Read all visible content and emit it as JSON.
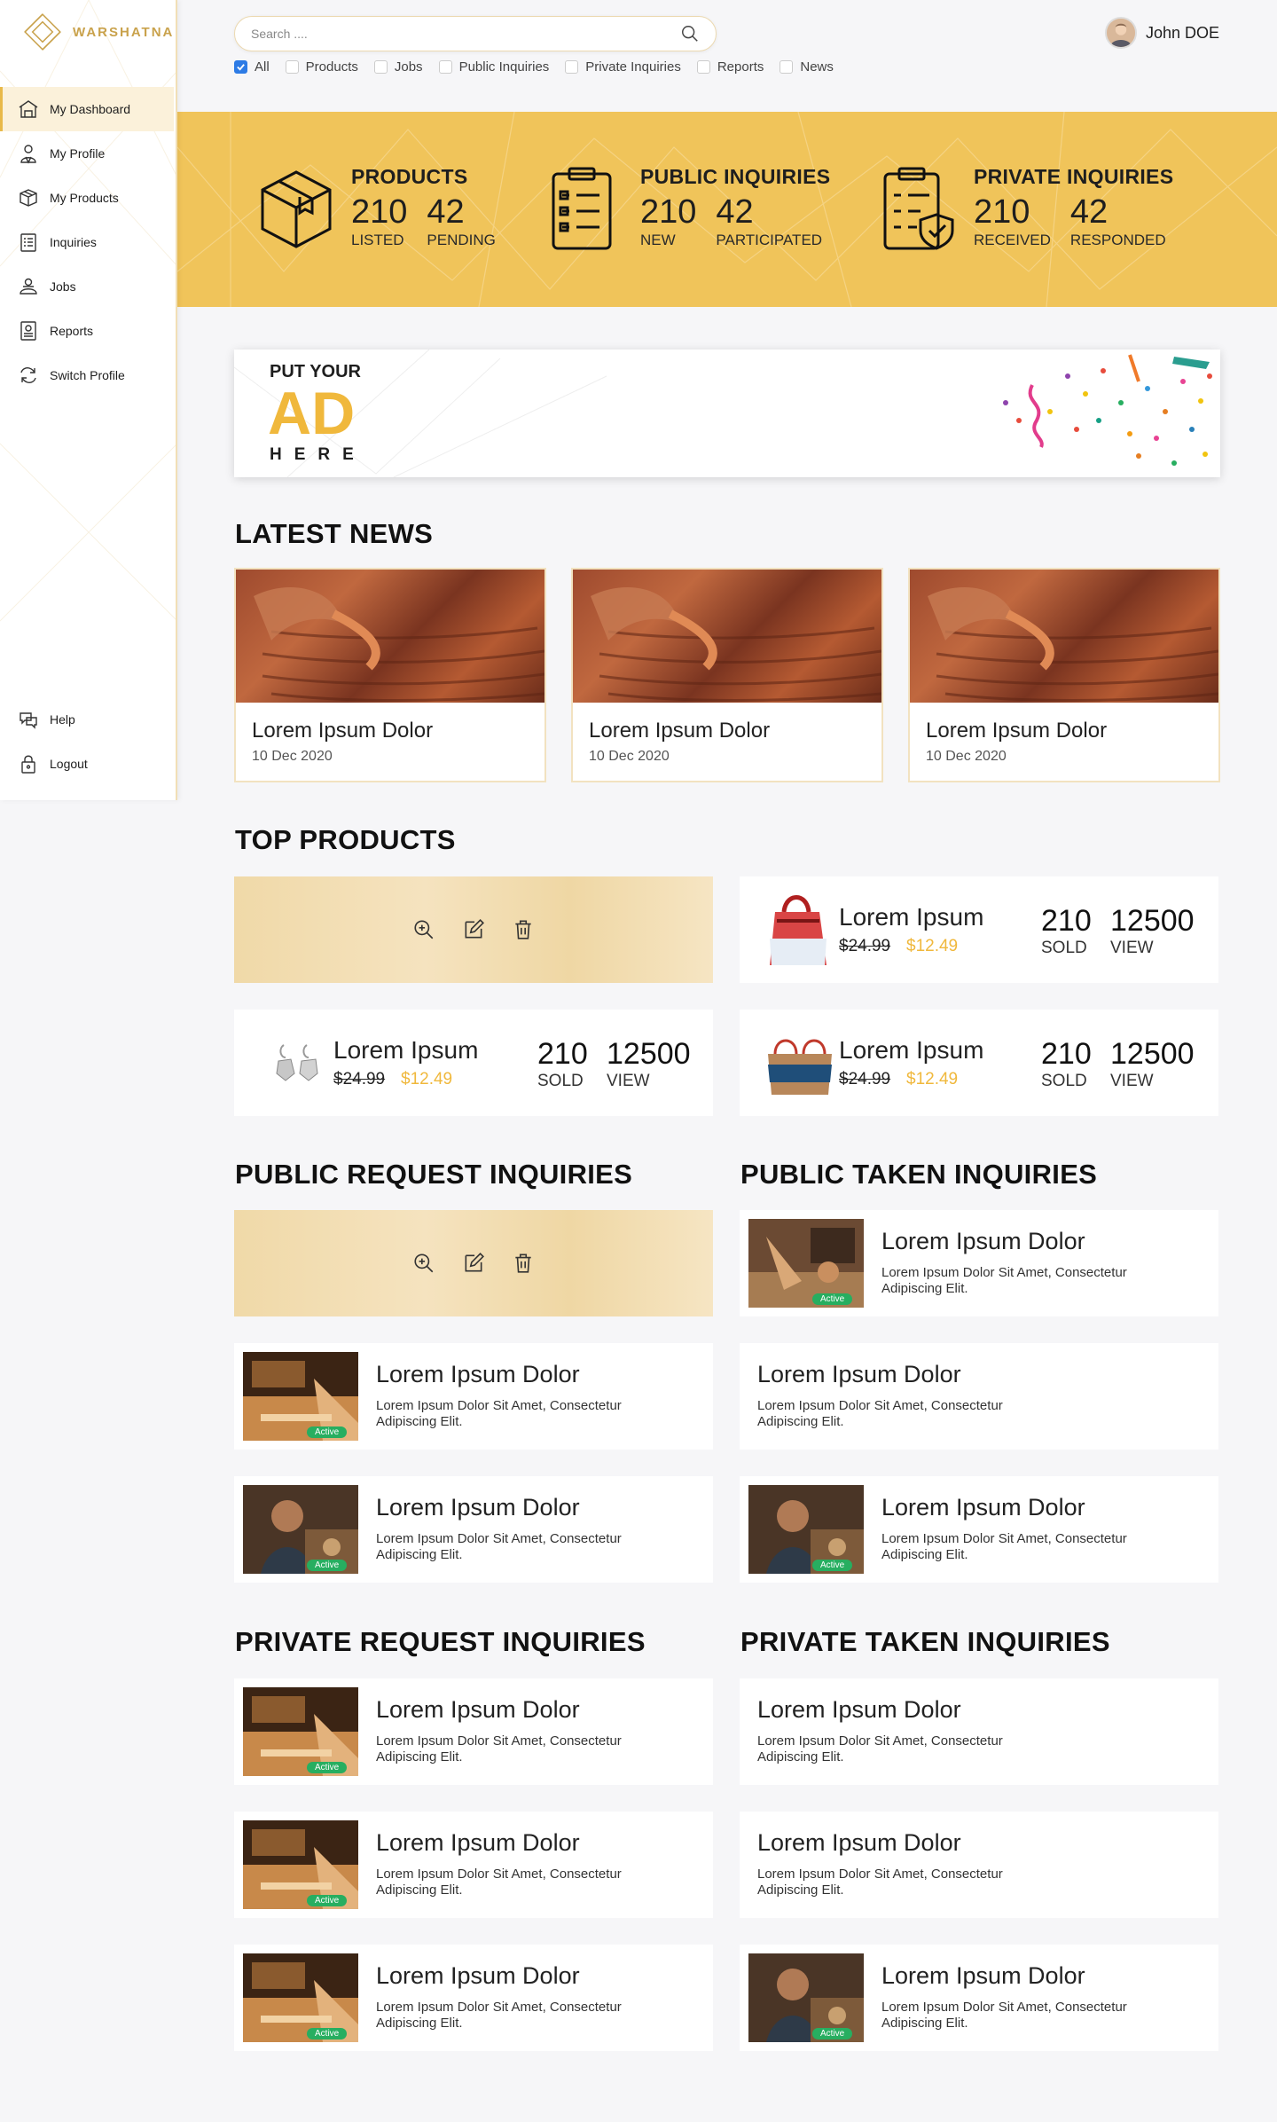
{
  "brand": {
    "name": "WARSHATNA"
  },
  "sidebar": {
    "items": [
      {
        "label": "My Dashboard",
        "icon": "dashboard-icon"
      },
      {
        "label": "My Profile",
        "icon": "profile-icon"
      },
      {
        "label": "My Products",
        "icon": "products-icon"
      },
      {
        "label": "Inquiries",
        "icon": "inquiries-icon"
      },
      {
        "label": "Jobs",
        "icon": "jobs-icon"
      },
      {
        "label": "Reports",
        "icon": "reports-icon"
      },
      {
        "label": "Switch Profile",
        "icon": "switch-icon"
      }
    ],
    "bottom": [
      {
        "label": "Help",
        "icon": "help-icon"
      },
      {
        "label": "Logout",
        "icon": "logout-icon"
      }
    ]
  },
  "search": {
    "placeholder": "Search ...."
  },
  "filters": [
    {
      "label": "All",
      "checked": true
    },
    {
      "label": "Products",
      "checked": false
    },
    {
      "label": "Jobs",
      "checked": false
    },
    {
      "label": "Public Inquiries",
      "checked": false
    },
    {
      "label": "Private Inquiries",
      "checked": false
    },
    {
      "label": "Reports",
      "checked": false
    },
    {
      "label": "News",
      "checked": false
    }
  ],
  "user": {
    "name": "John DOE"
  },
  "stats": [
    {
      "title": "PRODUCTS",
      "a": "210",
      "a_label": "LISTED",
      "b": "42",
      "b_label": "PENDING"
    },
    {
      "title": "PUBLIC INQUIRIES",
      "a": "210",
      "a_label": "NEW",
      "b": "42",
      "b_label": "PARTICIPATED"
    },
    {
      "title": "PRIVATE INQUIRIES",
      "a": "210",
      "a_label": "RECEIVED",
      "b": "42",
      "b_label": "RESPONDED"
    }
  ],
  "ad": {
    "line1": "PUT YOUR",
    "line2": "AD",
    "line3": "HERE"
  },
  "sections": {
    "news": "LATEST NEWS",
    "top_products": "TOP PRODUCTS",
    "public_request": "PUBLIC REQUEST INQUIRIES",
    "public_taken": "PUBLIC TAKEN INQUIRIES",
    "private_request": "PRIVATE REQUEST INQUIRIES",
    "private_taken": "PRIVATE TAKEN INQUIRIES"
  },
  "news": [
    {
      "title": "Lorem Ipsum Dolor",
      "date": "10 Dec 2020"
    },
    {
      "title": "Lorem Ipsum Dolor",
      "date": "10 Dec 2020"
    },
    {
      "title": "Lorem Ipsum Dolor",
      "date": "10 Dec 2020"
    }
  ],
  "products": [
    {
      "name": "Lorem Ipsum",
      "old_price": "$24.99",
      "new_price": "$12.49",
      "sold": "210",
      "sold_label": "SOLD",
      "views": "12500",
      "views_label": "VIEW"
    },
    {
      "name": "Lorem Ipsum",
      "old_price": "$24.99",
      "new_price": "$12.49",
      "sold": "210",
      "sold_label": "SOLD",
      "views": "12500",
      "views_label": "VIEW"
    },
    {
      "name": "Lorem Ipsum",
      "old_price": "$24.99",
      "new_price": "$12.49",
      "sold": "210",
      "sold_label": "SOLD",
      "views": "12500",
      "views_label": "VIEW"
    }
  ],
  "inquiry": {
    "title": "Lorem Ipsum Dolor",
    "desc": "Lorem Ipsum Dolor Sit Amet, Consectetur Adipiscing Elit.",
    "badge": "Active"
  },
  "colors": {
    "accent": "#f0c45a",
    "price": "#f0b83c",
    "badge": "#27ae60"
  }
}
